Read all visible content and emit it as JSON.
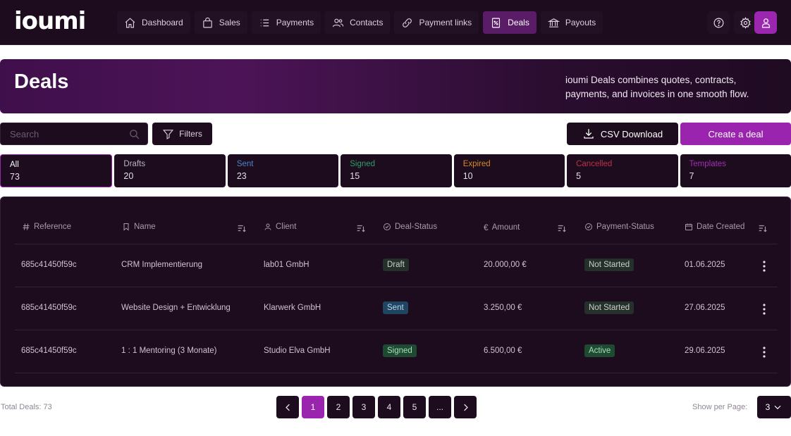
{
  "app": {
    "logo": "ioumi"
  },
  "nav": [
    {
      "label": "Dashboard",
      "icon": "home-icon"
    },
    {
      "label": "Sales",
      "icon": "shopping-bag-icon"
    },
    {
      "label": "Payments",
      "icon": "list-icon"
    },
    {
      "label": "Contacts",
      "icon": "users-icon"
    },
    {
      "label": "Payment links",
      "icon": "link-icon"
    },
    {
      "label": "Deals",
      "icon": "deal-document-icon",
      "active": true
    },
    {
      "label": "Payouts",
      "icon": "bank-icon"
    }
  ],
  "banner": {
    "title": "Deals",
    "description": "ioumi Deals combines quotes, contracts, payments, and invoices in one smooth flow."
  },
  "toolbar": {
    "search_placeholder": "Search",
    "filters_label": "Filters",
    "csv_label": "CSV Download",
    "create_label": "Create a deal"
  },
  "status_tabs": [
    {
      "label": "All",
      "count": "73",
      "color": "#ffffff",
      "active": true
    },
    {
      "label": "Drafts",
      "count": "20",
      "color": "#bdb3c2"
    },
    {
      "label": "Sent",
      "count": "23",
      "color": "#4a86c8"
    },
    {
      "label": "Signed",
      "count": "15",
      "color": "#2e9e6b"
    },
    {
      "label": "Expired",
      "count": "10",
      "color": "#d48a2a"
    },
    {
      "label": "Cancelled",
      "count": "5",
      "color": "#c0314a"
    },
    {
      "label": "Templates",
      "count": "7",
      "color": "#a12fb5"
    }
  ],
  "table": {
    "columns": [
      "Reference",
      "Name",
      "Client",
      "Deal-Status",
      "Amount",
      "Payment-Status",
      "Date Created"
    ],
    "rows": [
      {
        "reference": "685c41450f59c",
        "name": "CRM Implementierung",
        "client": "lab01 GmbH",
        "deal_status": "Draft",
        "amount": "20.000,00 €",
        "payment_status": "Not Started",
        "date": "01.06.2025"
      },
      {
        "reference": "685c41450f59c",
        "name": "Website Design + Entwicklung",
        "client": "Klarwerk GmbH",
        "deal_status": "Sent",
        "amount": "3.250,00 €",
        "payment_status": "Not Started",
        "date": "27.06.2025"
      },
      {
        "reference": "685c41450f59c",
        "name": "1 : 1 Mentoring (3 Monate)",
        "client": "Studio Elva GmbH",
        "deal_status": "Signed",
        "amount": "6.500,00 €",
        "payment_status": "Active",
        "date": "29.06.2025"
      }
    ]
  },
  "footer": {
    "total": "Total Deals: 73",
    "pages": [
      "1",
      "2",
      "3",
      "4",
      "5",
      "..."
    ],
    "current_page": "1",
    "per_page_label": "Show per Page:",
    "per_page_value": "3"
  }
}
